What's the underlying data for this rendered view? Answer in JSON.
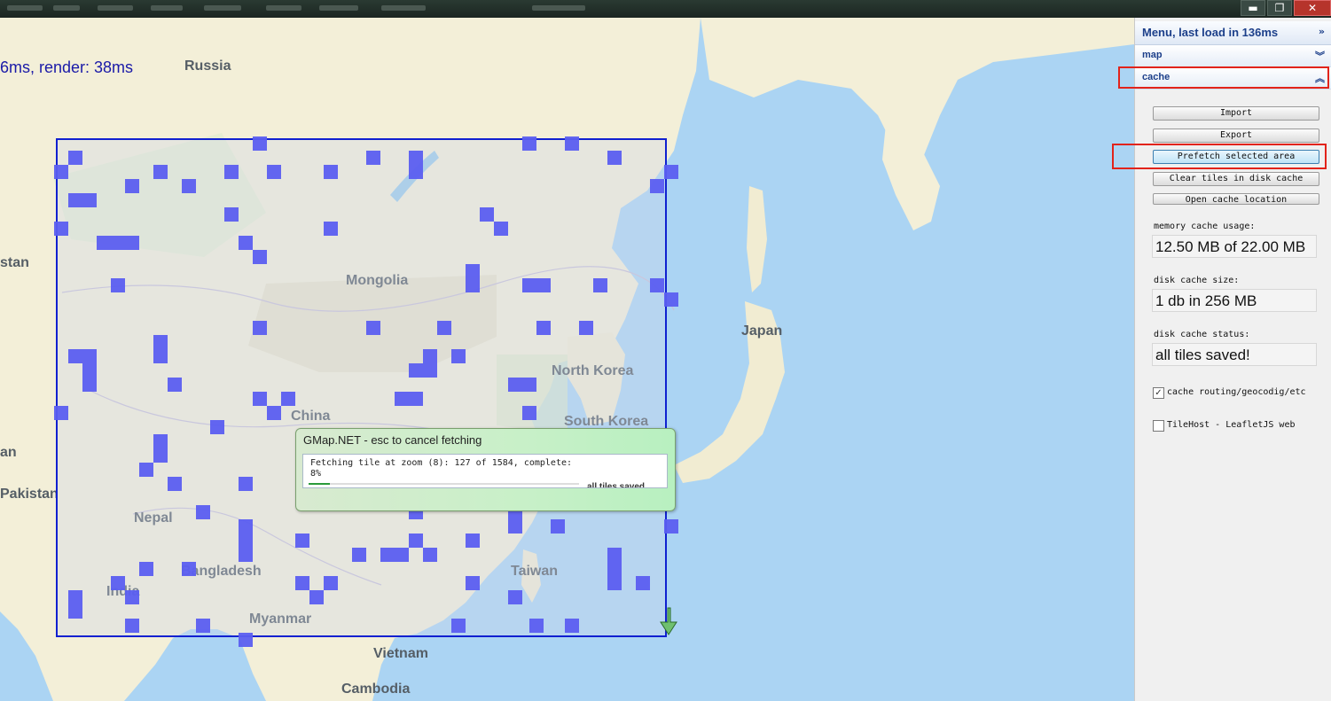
{
  "window": {
    "title": "GMap.NET",
    "controls": {
      "minimize": "▬",
      "restore": "❐",
      "close": "✕"
    }
  },
  "map": {
    "render_status": "6ms, render: 38ms",
    "labels": {
      "russia": "Russia",
      "mongolia": "Mongolia",
      "china": "China",
      "japan": "Japan",
      "north_korea": "North Korea",
      "south_korea": "South Korea",
      "nepal": "Nepal",
      "bangladesh": "Bangladesh",
      "india": "India",
      "myanmar": "Myanmar",
      "taiwan": "Taiwan",
      "vietnam": "Vietnam",
      "cambodia": "Cambodia",
      "pakistan": "Pakistan",
      "stan": "stan",
      "an": "an"
    },
    "colors": {
      "selection_border": "#1020d0",
      "tile": "#5b5ef0",
      "water": "#abd4f3",
      "land": "#f3efd8"
    }
  },
  "dialog": {
    "title": "GMap.NET - esc to cancel fetching",
    "line1": "Fetching tile at zoom (8): 127 of 1584, complete:",
    "line2": "8%",
    "progress": 0.08,
    "peek_text": "all tiles saved"
  },
  "panel": {
    "header": "Menu, last load in 136ms",
    "sections": {
      "map": "map",
      "cache": "cache"
    },
    "buttons": {
      "import": "Import",
      "export": "Export",
      "prefetch": "Prefetch selected area",
      "clear": "Clear tiles in disk cache",
      "open_location": "Open cache location"
    },
    "memory_label": "memory cache usage:",
    "memory_value": "12.50 MB of 22.00 MB",
    "disk_size_label": "disk cache size:",
    "disk_size_value": "1 db in 256 MB",
    "disk_status_label": "disk cache status:",
    "disk_status_value": "all tiles saved!",
    "check_routing": {
      "label": "cache routing/geocodig/etc",
      "checked": true
    },
    "check_tilehost": {
      "label": "TileHost - LeafletJS web",
      "checked": false
    }
  }
}
